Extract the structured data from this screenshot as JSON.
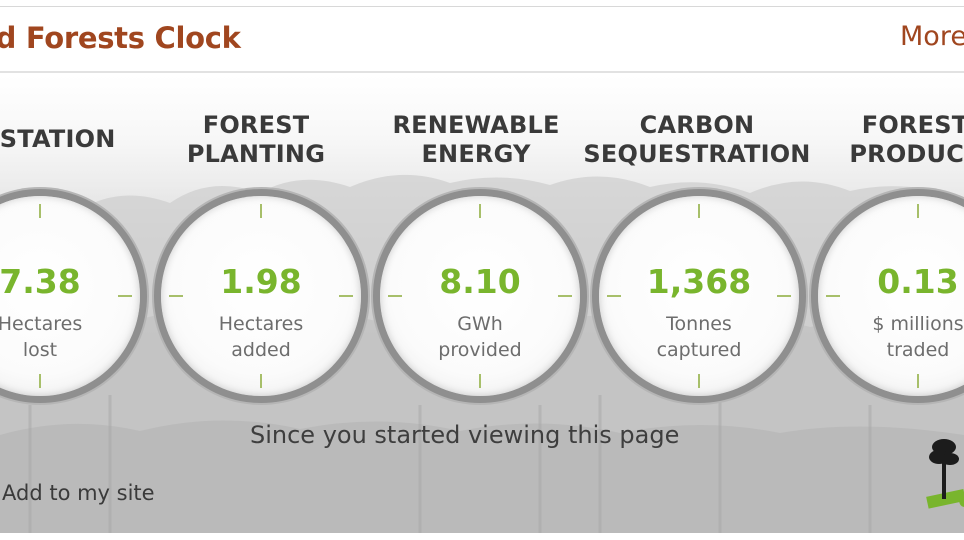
{
  "widget": {
    "title": "rld Forests Clock",
    "more_label": "More",
    "caption": "Since you started viewing this page",
    "add_label": "Add to my site"
  },
  "counters": [
    {
      "category_line1": "RESTATION",
      "category_line2": "",
      "value": "7.38",
      "unit_line1": "Hectares",
      "unit_line2": "lost"
    },
    {
      "category_line1": "FOREST",
      "category_line2": "PLANTING",
      "value": "1.98",
      "unit_line1": "Hectares",
      "unit_line2": "added"
    },
    {
      "category_line1": "RENEWABLE",
      "category_line2": "ENERGY",
      "value": "8.10",
      "unit_line1": "GWh",
      "unit_line2": "provided"
    },
    {
      "category_line1": "CARBON",
      "category_line2": "SEQUESTRATION",
      "value": "1,368",
      "unit_line1": "Tonnes",
      "unit_line2": "captured"
    },
    {
      "category_line1": "FOREST",
      "category_line2": "PRODUCT",
      "value": "0.13",
      "unit_line1": "$ millions",
      "unit_line2": "traded"
    }
  ],
  "colors": {
    "title": "#a0461f",
    "value": "#79b52d",
    "category": "#3a3a3a",
    "unit": "#6d6d6d"
  }
}
